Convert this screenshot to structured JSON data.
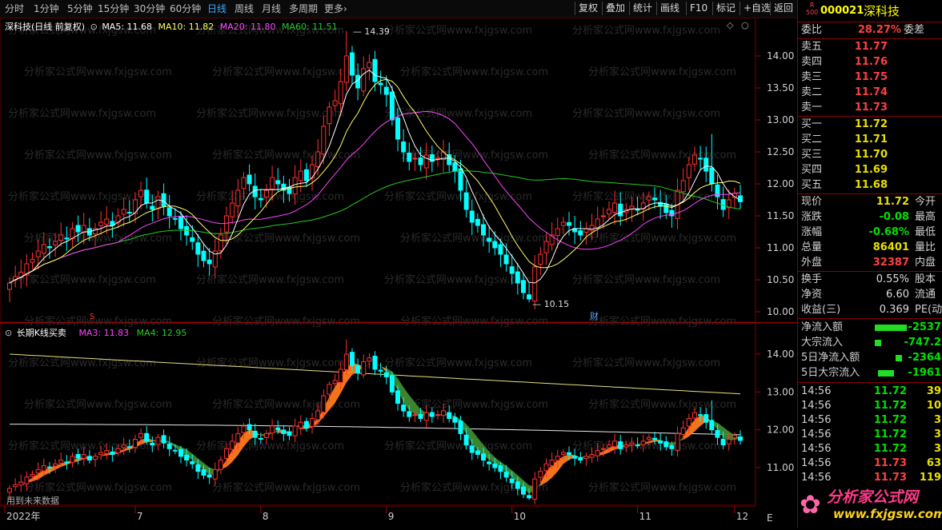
{
  "toolbar": {
    "periods": [
      "分时",
      "1分钟",
      "5分钟",
      "15分钟",
      "30分钟",
      "60分钟",
      "日线",
      "周线",
      "月线",
      "多周期",
      "更多›"
    ],
    "selected": "日线",
    "buttons": [
      "复权",
      "叠加",
      "统计",
      "画线",
      "F10",
      "标记",
      "+自选",
      "返回"
    ]
  },
  "main_legend": {
    "name": "深科技(日线 前复权)",
    "ma5": "MA5: 11.68",
    "ma10": "MA10: 11.82",
    "ma20": "MA20: 11.80",
    "ma60": "MA60: 11.51"
  },
  "sub_legend": {
    "name": "长期K线买卖",
    "ma3": "MA3: 11.83",
    "ma4": "MA4: 12.95"
  },
  "annotations": {
    "high": "14.39",
    "low": "10.15",
    "cai": "财",
    "s_mark": "S"
  },
  "axis": {
    "main_ticks": [
      "14.00",
      "13.50",
      "13.00",
      "12.50",
      "12.00",
      "11.50",
      "11.00",
      "10.50",
      "10.00"
    ],
    "sub_ticks": [
      "14.00",
      "13.00",
      "12.00",
      "11.00"
    ],
    "months": [
      "2022年",
      "7",
      "8",
      "9",
      "10",
      "11",
      "12"
    ],
    "footer_note": "用到未来数据",
    "corner": "E"
  },
  "watermark": "分析家公式网www.fxjgsw.com",
  "colors": {
    "up": "#ff3030",
    "down": "#00ffff",
    "ma5": "#ffffff",
    "ma10": "#ffff66",
    "ma20": "#ff44ff",
    "ma60": "#22cc22",
    "orange": "#ff7a1a",
    "green_band": "#3e8a2e",
    "ref_yellow": "#e6e07a"
  },
  "stock": {
    "badge_top": "R",
    "badge_bottom": "500",
    "code": "000021",
    "name": "深科技"
  },
  "ratio": {
    "label": "委比",
    "value": "28.27%",
    "label2": "委差"
  },
  "asks": [
    {
      "label": "卖五",
      "price": "11.77"
    },
    {
      "label": "卖四",
      "price": "11.76"
    },
    {
      "label": "卖三",
      "price": "11.75"
    },
    {
      "label": "卖二",
      "price": "11.74"
    },
    {
      "label": "卖一",
      "price": "11.73"
    }
  ],
  "bids": [
    {
      "label": "买一",
      "price": "11.72"
    },
    {
      "label": "买二",
      "price": "11.71"
    },
    {
      "label": "买三",
      "price": "11.70"
    },
    {
      "label": "买四",
      "price": "11.69"
    },
    {
      "label": "买五",
      "price": "11.68"
    }
  ],
  "quote": [
    {
      "label": "现价",
      "value": "11.72",
      "label2": "今开",
      "color": "yellow"
    },
    {
      "label": "涨跌",
      "value": "-0.08",
      "label2": "最高",
      "color": "green"
    },
    {
      "label": "涨幅",
      "value": "-0.68%",
      "label2": "最低",
      "color": "green"
    },
    {
      "label": "总量",
      "value": "86401",
      "label2": "量比",
      "color": "yellow"
    },
    {
      "label": "外盘",
      "value": "32387",
      "label2": "内盘",
      "color": "red"
    }
  ],
  "fund": [
    {
      "label": "换手",
      "value": "0.55%",
      "label2": "股本"
    },
    {
      "label": "净资",
      "value": "6.60",
      "label2": "流通"
    },
    {
      "label": "收益(三)",
      "value": "0.369",
      "label2": "PE(动)"
    }
  ],
  "flows": [
    {
      "label": "净流入额",
      "value": "-2537"
    },
    {
      "label": "大宗流入",
      "value": "-747.2"
    },
    {
      "label": "5日净流入额",
      "value": "-2364"
    },
    {
      "label": "5日大宗流入",
      "value": "-1961"
    }
  ],
  "ticks": [
    {
      "time": "14:56",
      "price": "11.72",
      "vol": "39"
    },
    {
      "time": "14:56",
      "price": "11.72",
      "vol": "10"
    },
    {
      "time": "14:56",
      "price": "11.72",
      "vol": "3"
    },
    {
      "time": "14:56",
      "price": "11.72",
      "vol": "3"
    },
    {
      "time": "14:56",
      "price": "11.72",
      "vol": "3"
    },
    {
      "time": "14:56",
      "price": "11.73",
      "vol": "63"
    },
    {
      "time": "14:56",
      "price": "11.73",
      "vol": "119"
    }
  ],
  "brand": {
    "text": "分析家公式网",
    "url": "www.fxjgsw.com"
  }
}
